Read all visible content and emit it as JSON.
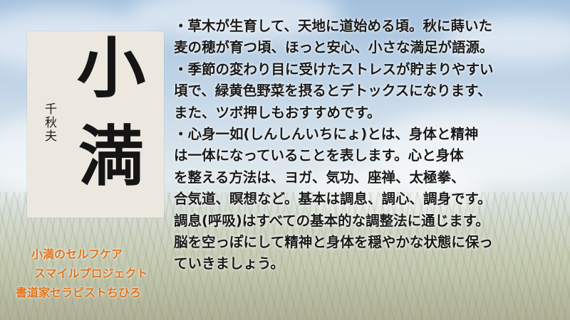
{
  "calligraphy": {
    "char_top": "小",
    "char_bottom": "満",
    "signature": "千秋夫"
  },
  "main_text": {
    "lines": [
      "・草木が生育して、天地に道始める頃。秋に蒔いた",
      "麦の穂が育つ頃、ほっと安心、小さな満足が語源。",
      "・季節の変わり目に受けたストレスが貯まりやすい",
      "頃で、緑黄色野菜を摂るとデトックスになります、",
      "また、ツボ押しもおすすめです。",
      "・心身一如(しんしんいちにょ)とは、身体と精神",
      "は一体になっていることを表します。心と身体",
      "を整える方法は、ヨガ、気功、座禅、太極拳、",
      "合気道、瞑想など。基本は調息、調心、調身です。",
      "調息(呼吸)はすべての基本的な調整法に通じます。",
      "脳を空っぽにして精神と身体を穏やかな状態に保っ",
      "ていきましょう。"
    ]
  },
  "credits": {
    "line1": "小満のセルフケア",
    "line2": "スマイルプロジェクト",
    "line3": "書道家セラピストちひろ"
  },
  "colors": {
    "credit_orange": "#e0731a",
    "text_dark": "#1a1a1a"
  }
}
